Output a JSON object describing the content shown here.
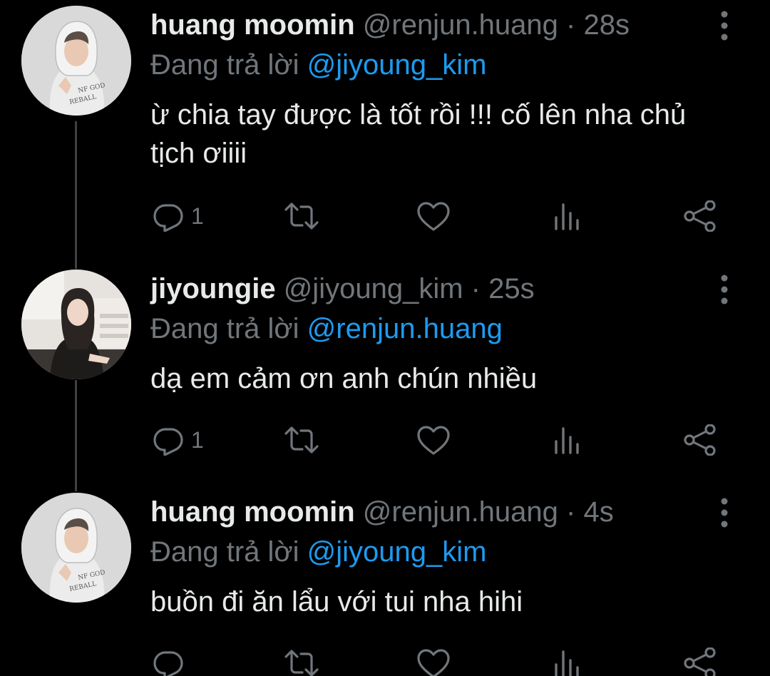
{
  "colors": {
    "background": "#000000",
    "text": "#e7e9ea",
    "muted": "#71767b",
    "accent": "#1d9bf0",
    "thread_line": "#3e4144"
  },
  "tweets": [
    {
      "name": "huang moomin",
      "handle": "@renjun.huang",
      "separator": "·",
      "time": "28s",
      "reply_prefix": "Đang trả lời",
      "reply_to": "@jiyoung_kim",
      "text": "ừ chia tay được là tốt rồi !!! cố lên nha chủ tịch ơiiii",
      "reply_count": "1",
      "icons": [
        "reply-icon",
        "retweet-icon",
        "like-icon",
        "views-icon",
        "share-icon",
        "more-icon"
      ]
    },
    {
      "name": "jiyoungie",
      "handle": "@jiyoung_kim",
      "separator": "·",
      "time": "25s",
      "reply_prefix": "Đang trả lời",
      "reply_to": "@renjun.huang",
      "text": "dạ em cảm ơn anh chún nhiều",
      "reply_count": "1",
      "icons": [
        "reply-icon",
        "retweet-icon",
        "like-icon",
        "views-icon",
        "share-icon",
        "more-icon"
      ]
    },
    {
      "name": "huang moomin",
      "handle": "@renjun.huang",
      "separator": "·",
      "time": "4s",
      "reply_prefix": "Đang trả lời",
      "reply_to": "@jiyoung_kim",
      "text": "buồn đi ăn lẩu với tui nha hihi",
      "reply_count": "",
      "icons": [
        "reply-icon",
        "retweet-icon",
        "like-icon",
        "views-icon",
        "share-icon",
        "more-icon"
      ]
    }
  ]
}
